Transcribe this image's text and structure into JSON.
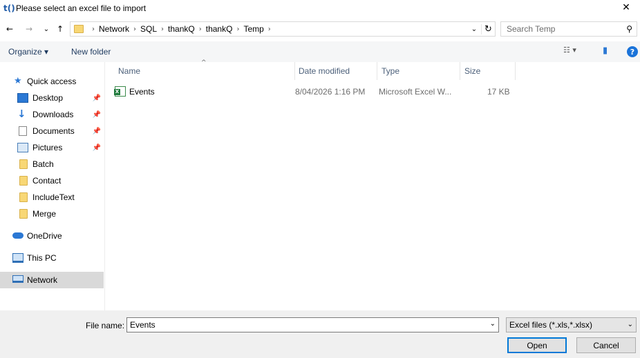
{
  "window": {
    "logo_text": "t()",
    "title": "Please select an excel file to import",
    "close_glyph": "✕"
  },
  "navigation": {
    "back_glyph": "←",
    "forward_glyph": "→",
    "recent_glyph": "⌄",
    "up_glyph": "↑",
    "breadcrumb": [
      "Network",
      "SQL",
      "thankQ",
      "thankQ",
      "Temp"
    ],
    "separator": "›",
    "dropdown_glyph": "⌄",
    "refresh_glyph": "↻"
  },
  "search": {
    "placeholder": "Search Temp",
    "icon": "search-icon",
    "glyph": "⚲"
  },
  "toolbar": {
    "organize_label": "Organize ▾",
    "new_folder_label": "New folder",
    "view_glyph": "☷ ▾",
    "preview_glyph": "▮",
    "help_glyph": "?"
  },
  "sidebar": {
    "items": [
      {
        "label": "Quick access",
        "icon": "star-icon",
        "pinned": false
      },
      {
        "label": "Desktop",
        "icon": "desktop-icon",
        "pinned": true
      },
      {
        "label": "Downloads",
        "icon": "download-icon",
        "pinned": true
      },
      {
        "label": "Documents",
        "icon": "document-icon",
        "pinned": true
      },
      {
        "label": "Pictures",
        "icon": "picture-icon",
        "pinned": true
      },
      {
        "label": "Batch",
        "icon": "folder-icon",
        "pinned": false
      },
      {
        "label": "Contact",
        "icon": "folder-icon",
        "pinned": false
      },
      {
        "label": "IncludeText",
        "icon": "folder-icon",
        "pinned": false
      },
      {
        "label": "Merge",
        "icon": "folder-icon",
        "pinned": false
      },
      {
        "label": "OneDrive",
        "icon": "cloud-icon",
        "pinned": false
      },
      {
        "label": "This PC",
        "icon": "computer-icon",
        "pinned": false
      },
      {
        "label": "Network",
        "icon": "network-icon",
        "pinned": false
      }
    ],
    "pin_glyph": "📌",
    "star_glyph": "★"
  },
  "file_list": {
    "sort_glyph": "^",
    "columns": [
      "Name",
      "Date modified",
      "Type",
      "Size"
    ],
    "rows": [
      {
        "name": "Events",
        "date_modified": "8/04/2026 1:16 PM",
        "type": "Microsoft Excel W...",
        "size": "17 KB",
        "icon": "excel-file-icon"
      }
    ]
  },
  "bottom": {
    "file_name_label": "File name:",
    "file_name_value": "Events",
    "dropdown_glyph": "⌄",
    "filter_value": "Excel files (*.xls,*.xlsx)",
    "open_label": "Open",
    "cancel_label": "Cancel"
  }
}
